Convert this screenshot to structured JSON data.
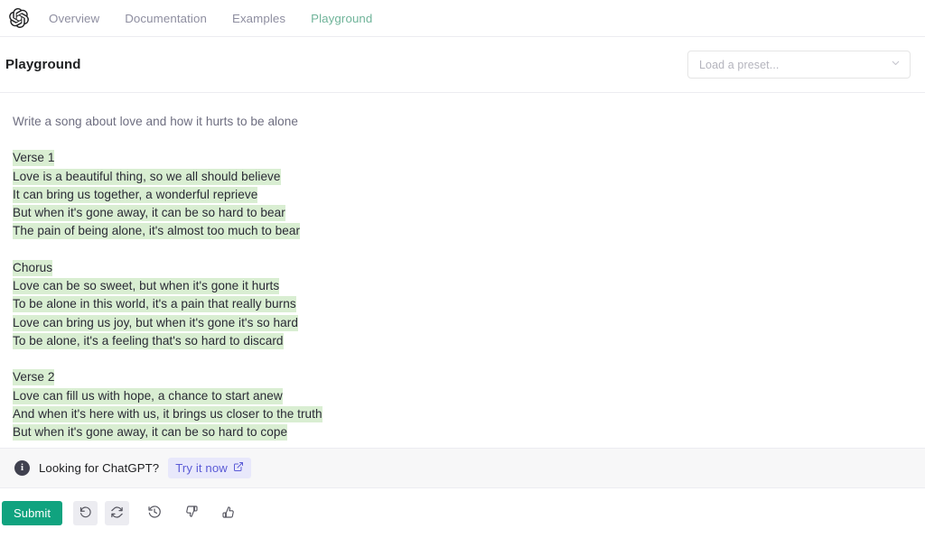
{
  "nav": {
    "logo_icon": "openai-logo-icon",
    "links": [
      {
        "label": "Overview",
        "active": false
      },
      {
        "label": "Documentation",
        "active": false
      },
      {
        "label": "Examples",
        "active": false
      },
      {
        "label": "Playground",
        "active": true
      }
    ]
  },
  "header": {
    "title": "Playground",
    "preset": {
      "placeholder": "Load a preset...",
      "value": "",
      "chevron_icon": "chevron-down-icon"
    }
  },
  "editor": {
    "prompt": "Write a song about love and how it hurts to be alone",
    "completion_stanzas": [
      {
        "lines": [
          "Verse 1",
          "Love is a beautiful thing, so we all should believe",
          "It can bring us together, a wonderful reprieve",
          "But when it's gone away, it can be so hard to bear",
          "The pain of being alone, it's almost too much to bear"
        ]
      },
      {
        "lines": [
          "Chorus",
          "Love can be so sweet, but when it's gone it hurts",
          "To be alone in this world, it's a pain that really burns",
          "Love can bring us joy, but when it's gone it's so hard",
          "To be alone, it's a feeling that's so hard to discard"
        ]
      },
      {
        "lines": [
          "Verse 2",
          "Love can fill us with hope, a chance to start anew",
          "And when it's here with us, it brings us closer to the truth",
          "But when it's gone away, it can be so hard to cope"
        ]
      }
    ]
  },
  "banner": {
    "info_icon": "info-icon",
    "text": "Looking for ChatGPT?",
    "link_label": "Try it now",
    "link_icon": "external-link-icon"
  },
  "toolbar": {
    "submit_label": "Submit",
    "buttons": [
      {
        "name": "undo-button",
        "icon": "undo-icon"
      },
      {
        "name": "regenerate-button",
        "icon": "regenerate-icon"
      },
      {
        "name": "history-button",
        "icon": "history-icon"
      },
      {
        "name": "thumbs-down-button",
        "icon": "thumbs-down-icon"
      },
      {
        "name": "thumbs-up-button",
        "icon": "thumbs-up-icon"
      }
    ]
  },
  "colors": {
    "brand_green": "#10a37f",
    "active_nav": "#70b49a",
    "highlight_green": "#d9eed2",
    "link_indigo": "#5b5bd6",
    "banner_bg": "#f7f7f8"
  }
}
